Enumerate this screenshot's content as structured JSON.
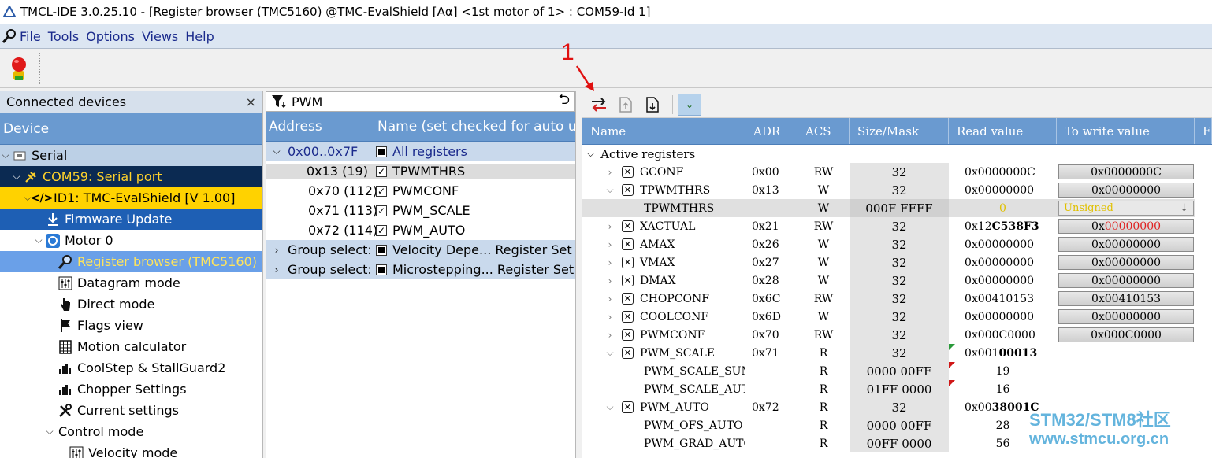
{
  "window": {
    "title": "TMCL-IDE 3.0.25.10 - [Register browser (TMC5160) @TMC-EvalShield [Aα] <1st motor of 1> : COM59-Id 1]"
  },
  "menu": [
    "File",
    "Tools",
    "Options",
    "Views",
    "Help"
  ],
  "annotation": "1",
  "left_panel": {
    "title": "Connected devices",
    "close": "×",
    "column": "Device",
    "tree": [
      {
        "label": "Serial",
        "icon": "serial-icon"
      },
      {
        "label": "COM59: Serial port",
        "icon": "plug-icon"
      },
      {
        "label": "ID1: TMC-EvalShield [V 1.00]",
        "icon": "code-icon"
      },
      {
        "label": "Firmware Update",
        "icon": "download-icon"
      },
      {
        "label": "Motor 0",
        "icon": "motor-icon"
      },
      {
        "label": "Register browser (TMC5160)",
        "icon": "magnifier-icon"
      },
      {
        "label": "Datagram mode",
        "icon": "sliders-icon"
      },
      {
        "label": "Direct mode",
        "icon": "hand-pointer-icon"
      },
      {
        "label": "Flags view",
        "icon": "flag-icon"
      },
      {
        "label": "Motion calculator",
        "icon": "calculator-icon"
      },
      {
        "label": "CoolStep & StallGuard2",
        "icon": "bar-chart-icon"
      },
      {
        "label": "Chopper Settings",
        "icon": "bar-chart-icon"
      },
      {
        "label": "Current settings",
        "icon": "tools-icon"
      },
      {
        "label": "Control mode",
        "icon": ""
      },
      {
        "label": "Velocity mode",
        "icon": "sliders-icon"
      }
    ]
  },
  "middle_panel": {
    "filter": "PWM",
    "col_address": "Address",
    "col_name": "Name (set checked for auto upd",
    "rows": [
      {
        "address": "0x00..0x7F",
        "name": "All registers"
      },
      {
        "address": "0x13 (19)",
        "name": "TPWMTHRS"
      },
      {
        "address": "0x70 (112)",
        "name": "PWMCONF"
      },
      {
        "address": "0x71 (113)",
        "name": "PWM_SCALE"
      },
      {
        "address": "0x72 (114)",
        "name": "PWM_AUTO"
      },
      {
        "address": "Group select:",
        "name": "Velocity Depe... Register Set"
      },
      {
        "address": "Group select:",
        "name": "Microstepping... Register Set"
      }
    ]
  },
  "right_panel": {
    "columns": {
      "name": "Name",
      "adr": "ADR",
      "acs": "ACS",
      "size": "Size/Mask",
      "read": "Read value",
      "write": "To write value",
      "f": "F"
    },
    "section": "Active registers",
    "rows": [
      {
        "name": "GCONF",
        "adr": "0x00",
        "acs": "RW",
        "size": "32",
        "read": "0x0000000C",
        "write": "0x0000000C"
      },
      {
        "name": "TPWMTHRS",
        "adr": "0x13",
        "acs": "W",
        "size": "32",
        "read": "0x00000000",
        "write": "0x00000000"
      },
      {
        "name": "TPWMTHRS",
        "adr": "",
        "acs": "W",
        "size": "000F FFFF",
        "read": "0",
        "write": "Unsigned"
      },
      {
        "name": "XACTUAL",
        "adr": "0x21",
        "acs": "RW",
        "size": "32",
        "read_prefix": "0x12",
        "read_bold": "C538F3",
        "write_prefix": "0x",
        "write_red": "00000000"
      },
      {
        "name": "AMAX",
        "adr": "0x26",
        "acs": "W",
        "size": "32",
        "read": "0x00000000",
        "write": "0x00000000"
      },
      {
        "name": "VMAX",
        "adr": "0x27",
        "acs": "W",
        "size": "32",
        "read": "0x00000000",
        "write": "0x00000000"
      },
      {
        "name": "DMAX",
        "adr": "0x28",
        "acs": "W",
        "size": "32",
        "read": "0x00000000",
        "write": "0x00000000"
      },
      {
        "name": "CHOPCONF",
        "adr": "0x6C",
        "acs": "RW",
        "size": "32",
        "read": "0x00410153",
        "write": "0x00410153"
      },
      {
        "name": "COOLCONF",
        "adr": "0x6D",
        "acs": "W",
        "size": "32",
        "read": "0x00000000",
        "write": "0x00000000"
      },
      {
        "name": "PWMCONF",
        "adr": "0x70",
        "acs": "RW",
        "size": "32",
        "read": "0x000C0000",
        "write": "0x000C0000"
      },
      {
        "name": "PWM_SCALE",
        "adr": "0x71",
        "acs": "R",
        "size": "32",
        "read_prefix": "0x001",
        "read_bold": "00013"
      },
      {
        "name": "PWM_SCALE_SUM",
        "adr": "",
        "acs": "R",
        "size": "0000 00FF",
        "read": "19"
      },
      {
        "name": "PWM_SCALE_AUTO",
        "adr": "",
        "acs": "R",
        "size": "01FF 0000",
        "read": "16"
      },
      {
        "name": "PWM_AUTO",
        "adr": "0x72",
        "acs": "R",
        "size": "32",
        "read_prefix": "0x00",
        "read_bold": "38001C"
      },
      {
        "name": "PWM_OFS_AUTO",
        "adr": "",
        "acs": "R",
        "size": "0000 00FF",
        "read": "28"
      },
      {
        "name": "PWM_GRAD_AUTO",
        "adr": "",
        "acs": "R",
        "size": "00FF 0000",
        "read": "56"
      }
    ]
  },
  "watermark": {
    "line1": "STM32/STM8社区",
    "line2": "www.stmcu.org.cn"
  }
}
